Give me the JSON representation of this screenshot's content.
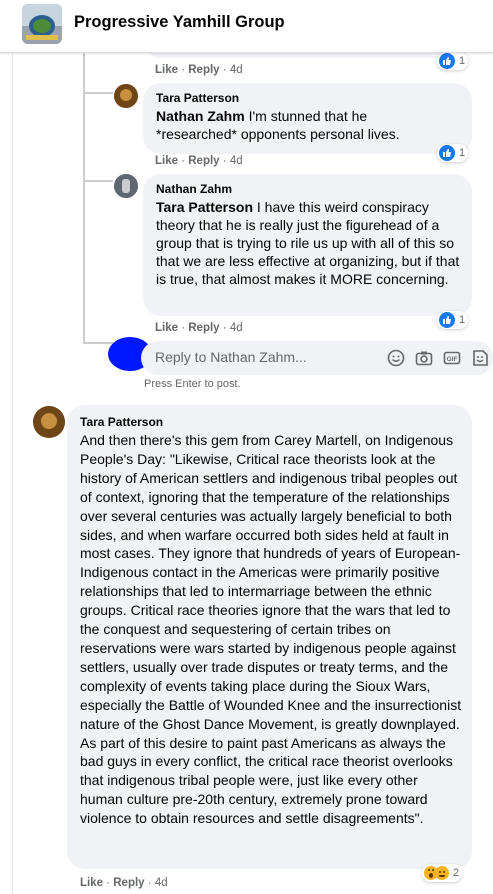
{
  "header": {
    "group_name": "Progressive Yamhill Group"
  },
  "comments": [
    {
      "actions": {
        "like": "Like",
        "reply": "Reply",
        "time": "4d"
      },
      "reactions": {
        "count": "1"
      }
    },
    {
      "author": "Tara Patterson",
      "mention": "Nathan Zahm",
      "text": "I'm stunned that he *researched* opponents personal lives.",
      "actions": {
        "like": "Like",
        "reply": "Reply",
        "time": "4d"
      },
      "reactions": {
        "count": "1"
      }
    },
    {
      "author": "Nathan Zahm",
      "mention": "Tara Patterson",
      "text": "I have this weird conspiracy theory that he is really just the figurehead of a group that is trying to rile us up with all of this so that we are less effective at organizing, but if that is true, that almost makes it MORE concerning.",
      "actions": {
        "like": "Like",
        "reply": "Reply",
        "time": "4d"
      },
      "reactions": {
        "count": "1"
      }
    },
    {
      "author": "Tara Patterson",
      "text": "And then there's this gem from Carey Martell, on Indigenous People's Day: \"Likewise, Critical race theorists look at the history of American settlers and indigenous tribal peoples out of context, ignoring that the temperature of the relationships over several centuries was actually largely beneficial to both sides, and when warfare occurred both sides held at fault in most cases. They ignore that hundreds of years of European-Indigenous contact in the Americas were primarily positive relationships that led to intermarriage between the ethnic groups. Critical race theories ignore that the wars that led to the conquest and sequestering of certain tribes on reservations were wars started by indigenous people against settlers, usually over trade disputes or treaty terms, and the complexity of events taking place during the Sioux Wars, especially the Battle of Wounded Knee and the insurrectionist nature of the Ghost Dance Movement, is greatly downplayed. As part of this desire to paint past Americans as always the bad guys in every conflict, the critical race theorist overlooks that indigenous tribal people were, just like every other human culture pre-20th century, extremely prone toward violence to obtain resources and settle disagreements\".",
      "actions": {
        "like": "Like",
        "reply": "Reply",
        "time": "4d"
      },
      "reactions": {
        "count": "2"
      }
    }
  ],
  "reply_box": {
    "placeholder": "Reply to Nathan Zahm...",
    "hint": "Press Enter to post."
  },
  "colors": {
    "accent": "#1877f2",
    "bubble": "#f0f2f5",
    "secondary_text": "#65676b"
  }
}
